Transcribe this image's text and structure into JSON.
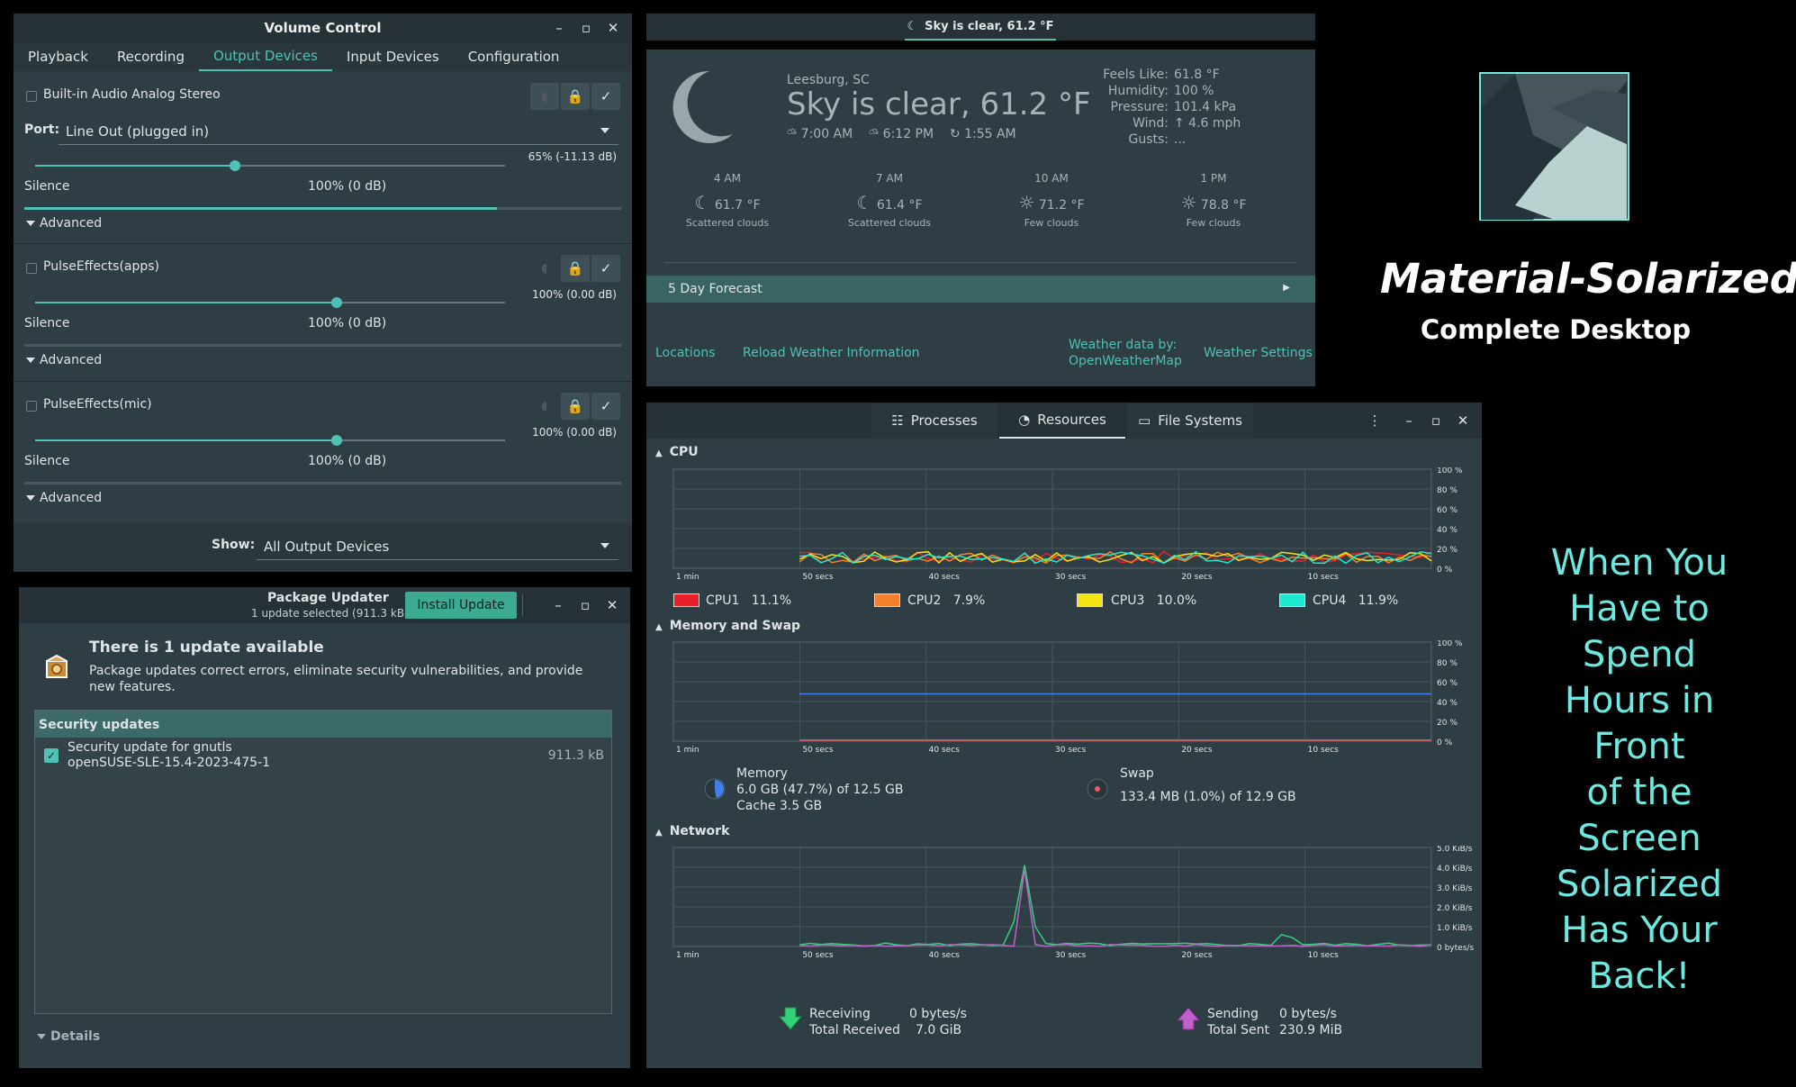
{
  "volume": {
    "title": "Volume Control",
    "tabs": [
      "Playback",
      "Recording",
      "Output Devices",
      "Input Devices",
      "Configuration"
    ],
    "devices": [
      {
        "name": "Built-in Audio Analog Stereo",
        "level": "65% (-11.13 dB)",
        "silence": "Silence",
        "ref": "100% (0 dB)",
        "advanced": "Advanced",
        "volume_fraction": 0.65,
        "meter_fraction": 0.79
      },
      {
        "name": "PulseEffects(apps)",
        "level": "100% (0.00 dB)",
        "silence": "Silence",
        "ref": "100% (0 dB)",
        "advanced": "Advanced",
        "volume_fraction": 1.0,
        "meter_fraction": 0
      },
      {
        "name": "PulseEffects(mic)",
        "level": "100% (0.00 dB)",
        "silence": "Silence",
        "ref": "100% (0 dB)",
        "advanced": "Advanced",
        "volume_fraction": 1.0,
        "meter_fraction": 0
      }
    ],
    "port_label": "Port:",
    "port_value": "Line Out (plugged in)",
    "show_label": "Show:",
    "show_value": "All Output Devices"
  },
  "updater": {
    "title": "Package Updater",
    "subtitle": "1 update selected (911.3 kB)",
    "install_label": "Install Update",
    "heading": "There is 1 update available",
    "description": "Package updates correct errors, eliminate security vulnerabilities, and provide new features.",
    "group": "Security updates",
    "item_name": "Security update for gnutls",
    "item_id": "openSUSE-SLE-15.4-2023-475-1",
    "item_size": "911.3 kB",
    "details": "Details"
  },
  "weather": {
    "panel_label": "Sky is clear, 61.2 °F",
    "location": "Leesburg, SC",
    "summary": "Sky is clear, 61.2 °F",
    "sunrise": "7:00 AM",
    "sunset": "6:12 PM",
    "updated": "1:55 AM",
    "details": [
      {
        "k": "Feels Like:",
        "v": "61.8 °F"
      },
      {
        "k": "Humidity:",
        "v": "100 %"
      },
      {
        "k": "Pressure:",
        "v": "101.4 kPa"
      },
      {
        "k": "Wind:",
        "v": "↑ 4.6 mph"
      },
      {
        "k": "Gusts:",
        "v": "..."
      }
    ],
    "hourly": [
      {
        "time": "4 AM",
        "temp": "61.7 °F",
        "cond": "Scattered clouds",
        "icon": "moon-cloud-icon"
      },
      {
        "time": "7 AM",
        "temp": "61.4 °F",
        "cond": "Scattered clouds",
        "icon": "moon-cloud-icon"
      },
      {
        "time": "10 AM",
        "temp": "71.2 °F",
        "cond": "Few clouds",
        "icon": "sun-cloud-icon"
      },
      {
        "time": "1 PM",
        "temp": "78.8 °F",
        "cond": "Few clouds",
        "icon": "sun-cloud-icon"
      }
    ],
    "forecast_label": "5 Day Forecast",
    "links": {
      "locations": "Locations",
      "reload": "Reload Weather Information",
      "data_by_1": "Weather data by:",
      "data_by_2": "OpenWeatherMap",
      "settings": "Weather Settings"
    }
  },
  "branding": {
    "title": "Material-Solarized",
    "subtitle": "Complete Desktop",
    "tagline": [
      "When You",
      "Have to",
      "Spend",
      "Hours in",
      "Front",
      "of the",
      "Screen",
      "Solarized",
      "Has Your",
      "Back!"
    ],
    "accent": "#6ce9e0"
  },
  "sysmon": {
    "tabs": [
      "Processes",
      "Resources",
      "File Systems"
    ],
    "cpu_label": "CPU",
    "mem_label": "Memory and Swap",
    "net_label": "Network",
    "x_ticks": [
      "1 min",
      "50 secs",
      "40 secs",
      "30 secs",
      "20 secs",
      "10 secs"
    ],
    "pct_ticks": [
      "100 %",
      "80 %",
      "60 %",
      "40 %",
      "20 %",
      "0 %"
    ],
    "net_ticks": [
      "5.0 KiB/s",
      "4.0 KiB/s",
      "3.0 KiB/s",
      "2.0 KiB/s",
      "1.0 KiB/s",
      "0 bytes/s"
    ],
    "cpus": [
      {
        "name": "CPU1",
        "value": "11.1%",
        "color": "#e8202a"
      },
      {
        "name": "CPU2",
        "value": "7.9%",
        "color": "#f5802c"
      },
      {
        "name": "CPU3",
        "value": "10.0%",
        "color": "#f4e312"
      },
      {
        "name": "CPU4",
        "value": "11.9%",
        "color": "#1ee8d0"
      }
    ],
    "memory": {
      "label": "Memory",
      "used": "6.0 GB (47.7%) of 12.5 GB",
      "cache": "Cache 3.5 GB",
      "fraction": 0.477,
      "color": "#3f7ff0"
    },
    "swap": {
      "label": "Swap",
      "used": "133.4 MB (1.0%) of 12.9 GB",
      "fraction": 0.01,
      "color": "#f05a5a"
    },
    "receiving": {
      "label": "Receiving",
      "rate": "0 bytes/s",
      "total_label": "Total Received",
      "total": "7.0 GiB",
      "color": "#33d17a"
    },
    "sending": {
      "label": "Sending",
      "rate": "0 bytes/s",
      "total_label": "Total Sent",
      "total": "230.9 MiB",
      "color": "#c061cb"
    }
  }
}
